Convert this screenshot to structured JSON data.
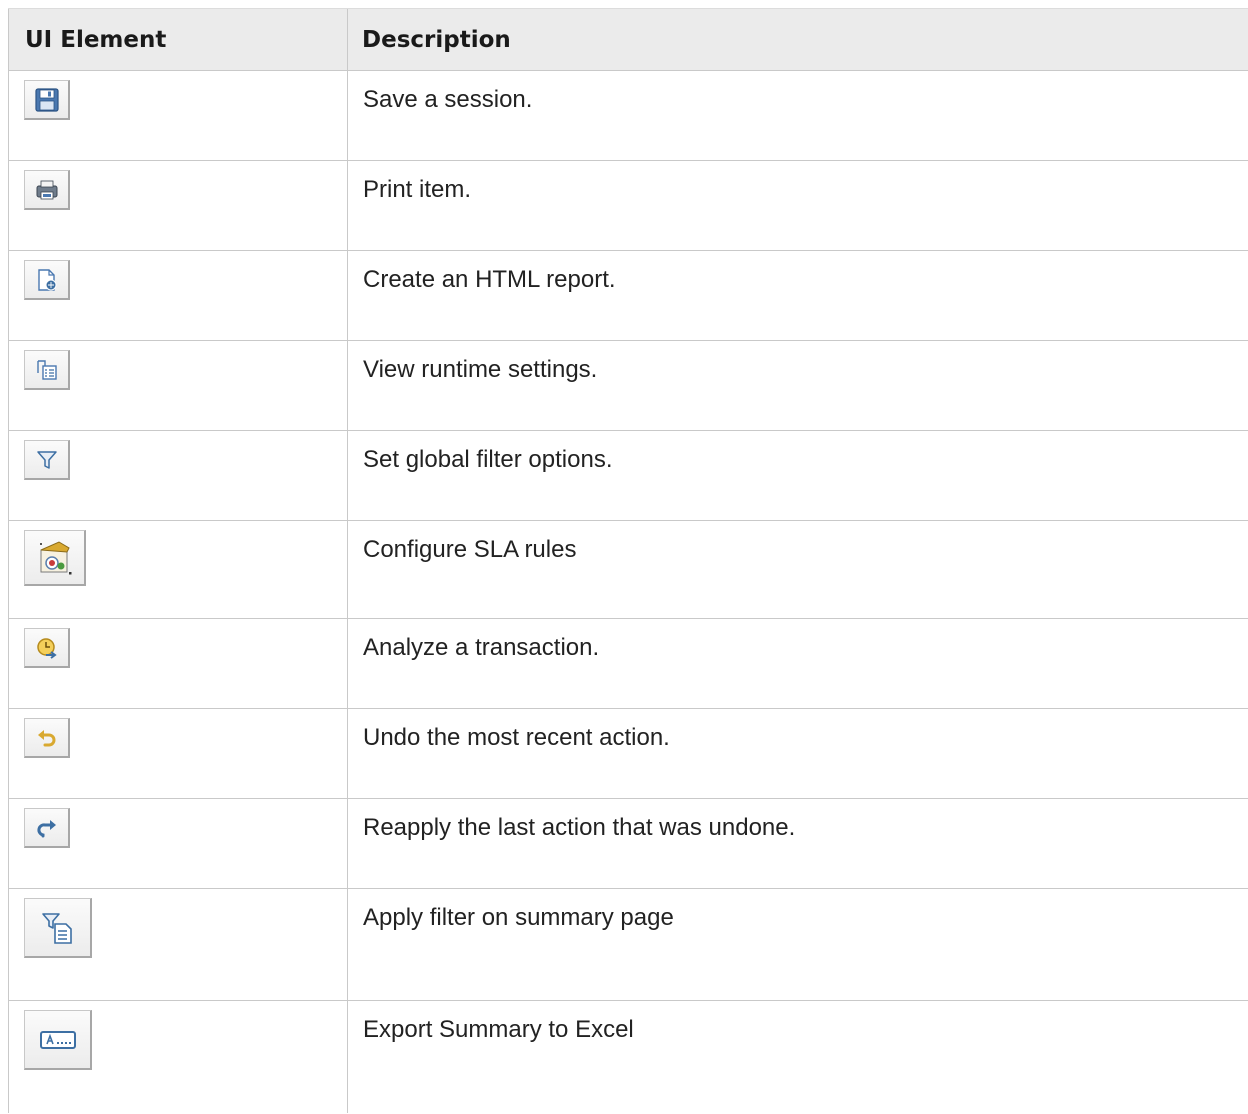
{
  "table": {
    "headers": [
      "UI Element",
      "Description"
    ],
    "rows": [
      {
        "icon": "save-icon",
        "description": "Save a session."
      },
      {
        "icon": "print-icon",
        "description": "Print item."
      },
      {
        "icon": "html-report-icon",
        "description": "Create an HTML report."
      },
      {
        "icon": "runtime-settings-icon",
        "description": "View runtime settings."
      },
      {
        "icon": "filter-icon",
        "description": "Set global filter options."
      },
      {
        "icon": "sla-rules-icon",
        "description": "Configure SLA rules"
      },
      {
        "icon": "analyze-transaction-icon",
        "description": "Analyze a transaction."
      },
      {
        "icon": "undo-icon",
        "description": "Undo the most recent action."
      },
      {
        "icon": "redo-icon",
        "description": "Reapply the last action that was undone."
      },
      {
        "icon": "summary-filter-icon",
        "description": "Apply filter on summary page"
      },
      {
        "icon": "export-excel-icon",
        "description": "Export Summary to Excel"
      }
    ]
  },
  "colors": {
    "header_bg": "#ebebeb",
    "border": "#c9c9c9",
    "icon_blue": "#3d6fa3",
    "icon_gold": "#d9a930"
  }
}
